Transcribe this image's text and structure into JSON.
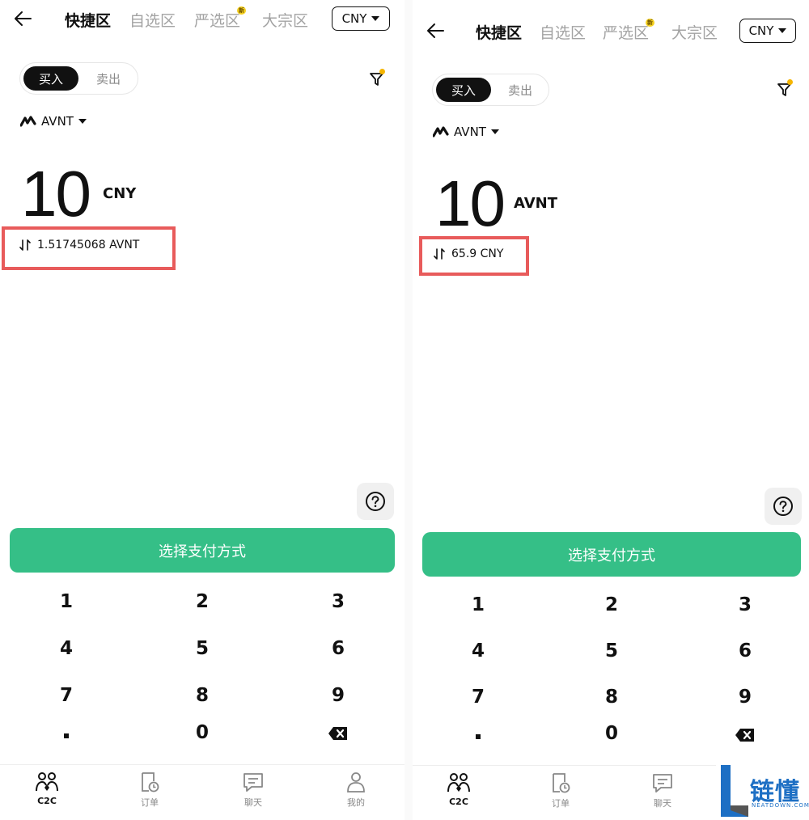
{
  "colors": {
    "accent_green": "#35bf87",
    "highlight_red": "#e85b5b",
    "badge_yellow": "#f5d020"
  },
  "nav_tabs": [
    "快捷区",
    "自选区",
    "严选区",
    "大宗区"
  ],
  "new_badge": "新",
  "currency_select": "CNY",
  "trade_toggle": {
    "buy": "买入",
    "sell": "卖出"
  },
  "coin": "AVNT",
  "pay_button": "选择支付方式",
  "keypad": [
    "1",
    "2",
    "3",
    "4",
    "5",
    "6",
    "7",
    "8",
    "9",
    "·",
    "0",
    "⌫"
  ],
  "bottom_nav": [
    "C2C",
    "订单",
    "聊天",
    "我的"
  ],
  "left": {
    "amount": "10",
    "unit": "CNY",
    "converted": "1.51745068 AVNT"
  },
  "right": {
    "amount": "10",
    "unit": "AVNT",
    "converted": "65.9 CNY"
  },
  "watermark": {
    "title": "链懂",
    "sub": "NEATDOWN.COM"
  }
}
